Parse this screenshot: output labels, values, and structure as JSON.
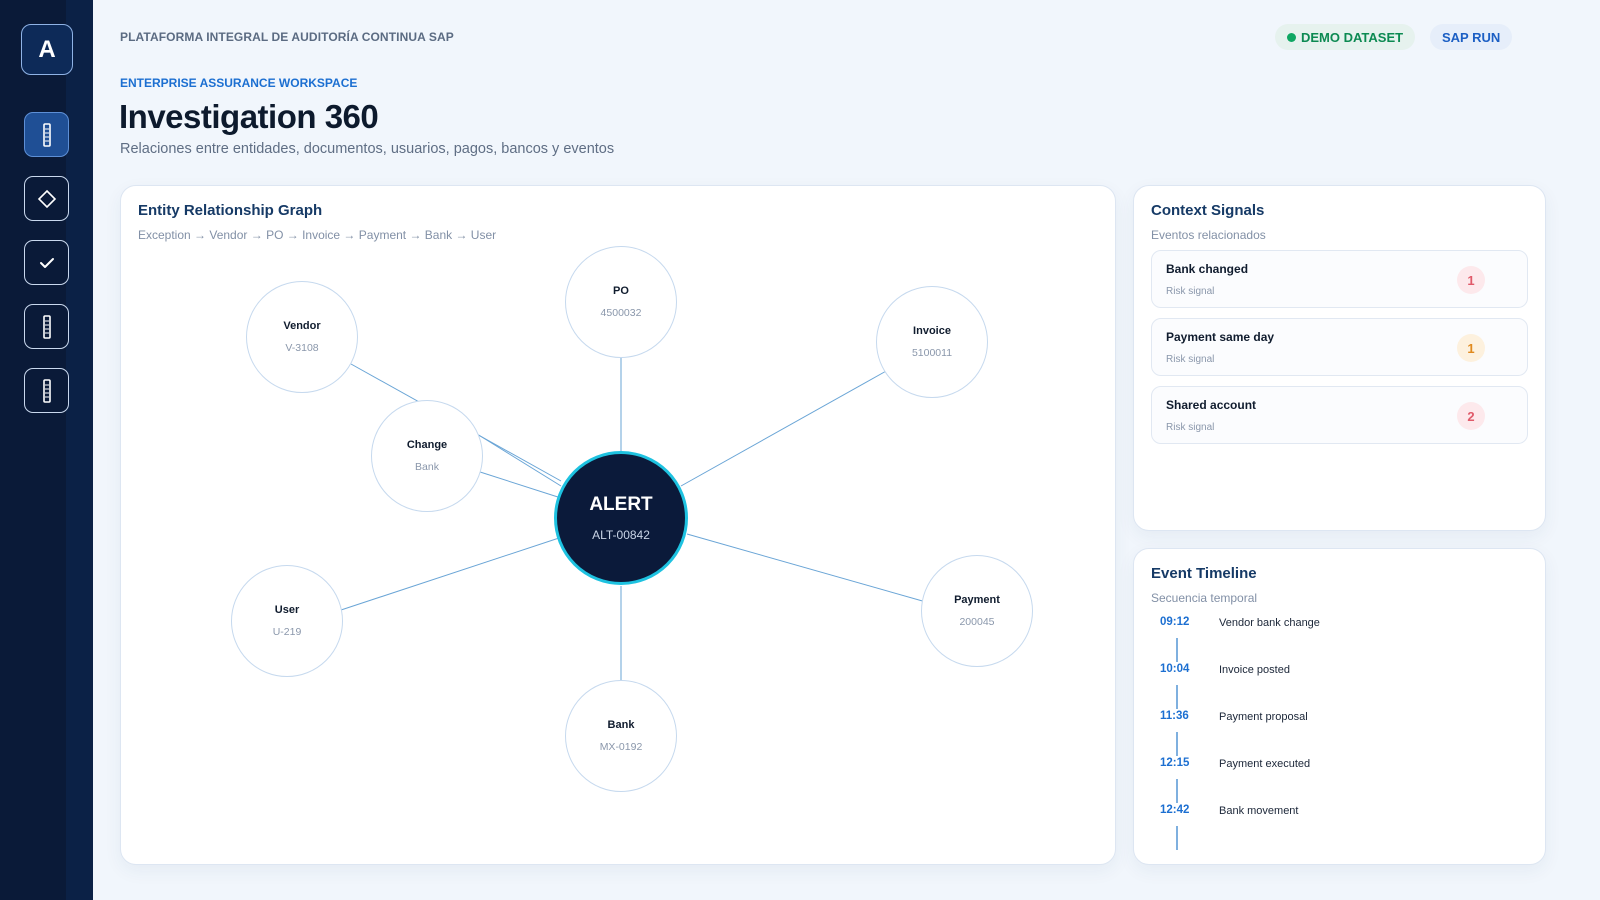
{
  "app": {
    "logo_letter": "A",
    "platform_title": "PLATAFORMA INTEGRAL DE AUDITORÍA CONTINUA SAP",
    "badges": {
      "demo": "DEMO DATASET",
      "sap": "SAP RUN"
    },
    "colors": {
      "accent": "#1c6fd1",
      "navy": "#0b1a3a",
      "alert_ring": "#1ec2e0",
      "success": "#0fa763"
    }
  },
  "sidebar": {
    "items": [
      {
        "name": "list-icon",
        "active": true
      },
      {
        "name": "diamond-icon",
        "active": false
      },
      {
        "name": "check-icon",
        "active": false
      },
      {
        "name": "list-icon",
        "active": false
      },
      {
        "name": "list-icon",
        "active": false
      }
    ]
  },
  "header": {
    "eyebrow": "ENTERPRISE ASSURANCE WORKSPACE",
    "title": "Investigation 360",
    "subtitle": "Relaciones entre entidades, documentos, usuarios, pagos, bancos y eventos"
  },
  "graph": {
    "title": "Entity Relationship Graph",
    "path": "Exception → Vendor → PO → Invoice → Payment → Bank → User",
    "center": {
      "label": "ALERT",
      "value": "ALT-00842"
    },
    "nodes": [
      {
        "label": "Vendor",
        "value": "V-3108"
      },
      {
        "label": "PO",
        "value": "4500032"
      },
      {
        "label": "Invoice",
        "value": "5100011"
      },
      {
        "label": "Change",
        "value": "Bank"
      },
      {
        "label": "User",
        "value": "U-219"
      },
      {
        "label": "Payment",
        "value": "200045"
      },
      {
        "label": "Bank",
        "value": "MX-0192"
      }
    ]
  },
  "signals": {
    "title": "Context Signals",
    "subtitle": "Eventos relacionados",
    "items": [
      {
        "title": "Bank changed",
        "type": "Risk signal",
        "count": "1",
        "color": "#e05a6a",
        "bg": "#fde9ec"
      },
      {
        "title": "Payment same day",
        "type": "Risk signal",
        "count": "1",
        "color": "#e08a1e",
        "bg": "#fdf1de"
      },
      {
        "title": "Shared account",
        "type": "Risk signal",
        "count": "2",
        "color": "#e05a6a",
        "bg": "#fde9ec"
      }
    ]
  },
  "timeline": {
    "title": "Event Timeline",
    "subtitle": "Secuencia temporal",
    "events": [
      {
        "time": "09:12",
        "event": "Vendor bank change"
      },
      {
        "time": "10:04",
        "event": "Invoice posted"
      },
      {
        "time": "11:36",
        "event": "Payment proposal"
      },
      {
        "time": "12:15",
        "event": "Payment executed"
      },
      {
        "time": "12:42",
        "event": "Bank movement"
      }
    ]
  }
}
